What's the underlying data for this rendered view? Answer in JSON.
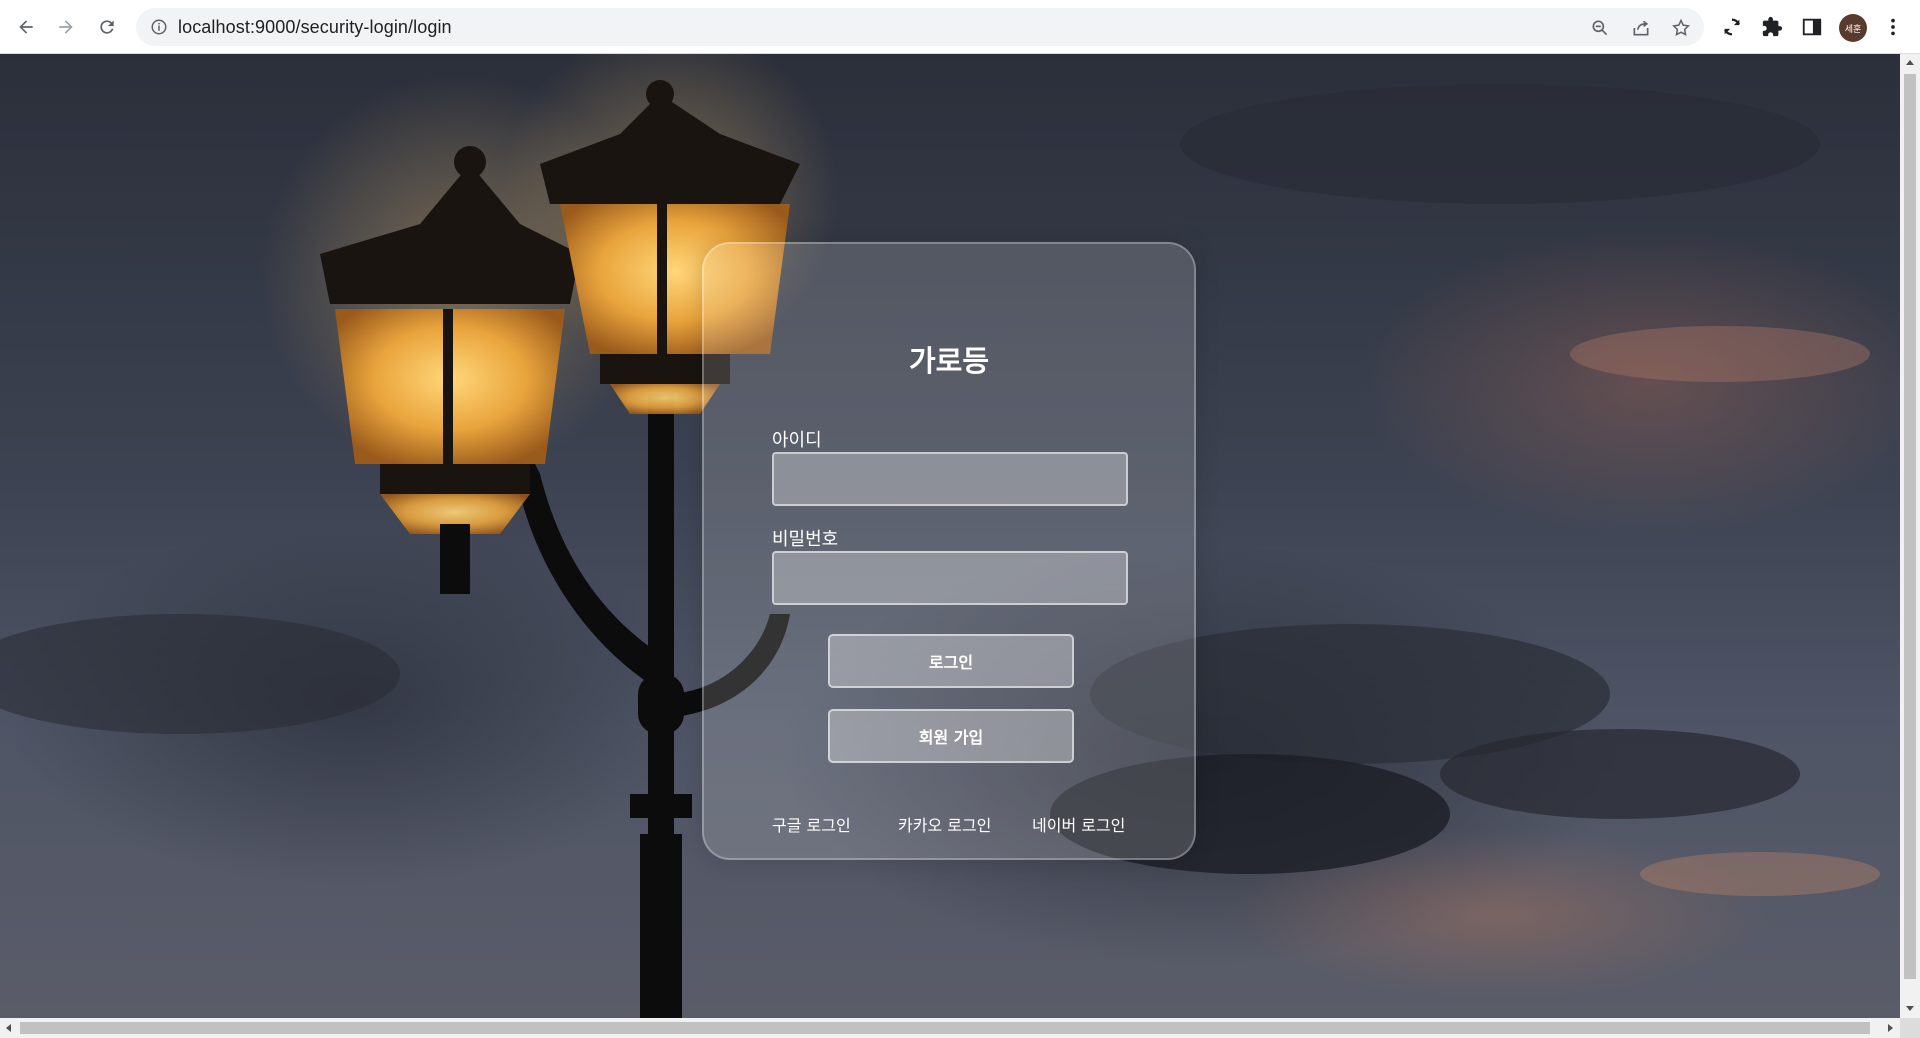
{
  "browser": {
    "url": "localhost:9000/security-login/login",
    "profile_initials": "세훈",
    "icons": [
      "back-arrow-icon",
      "forward-arrow-icon",
      "reload-icon",
      "info-icon",
      "zoom-icon",
      "share-icon",
      "bookmark-star-icon",
      "sync-icon",
      "extensions-puzzle-icon",
      "side-panel-icon",
      "more-vert-icon"
    ]
  },
  "login": {
    "title": "가로등",
    "id_label": "아이디",
    "id_value": "",
    "password_label": "비밀번호",
    "password_value": "",
    "login_button": "로그인",
    "signup_button": "회원 가입",
    "google_login": "구글 로그인",
    "kakao_login": "카카오 로그인",
    "naver_login": "네이버 로그인"
  },
  "colors": {
    "card_text": "#ffffff",
    "lamp_glow": "#f2b64a",
    "sky_dark": "#2b2f3a"
  }
}
